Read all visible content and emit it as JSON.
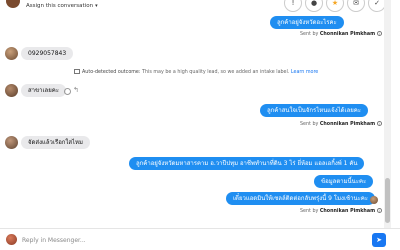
{
  "header": {
    "assign_label": "Assign this conversation",
    "caret": "▾",
    "buttons": [
      {
        "name": "alert-icon",
        "glyph": "!"
      },
      {
        "name": "tag-icon",
        "glyph": "●"
      },
      {
        "name": "star-icon",
        "glyph": "★"
      },
      {
        "name": "mail-icon",
        "glyph": "✉"
      },
      {
        "name": "check-icon",
        "glyph": "✓"
      }
    ]
  },
  "messages": {
    "m1": {
      "text": "ลูกค้าอยู่จังหวัดอะไรคะ"
    },
    "m2": {
      "text": "0929057843"
    },
    "m3": {
      "text": "สาขาเลยคะ"
    },
    "m4": {
      "text": "ลูกค้าสนใจเป็นจักรไหนแจ้งได้เลยคะ"
    },
    "m5": {
      "text": "จัดส่งแล้วเรือกใสไหม"
    },
    "m6": {
      "text": "ลูกค้าอยู่จังหวัดมหาสารคาม อ.วาปีปทุม อาชีพทำนาที่ดิน 3 ไร่ ยี่ห้อม แอลเอกิ้งพ์ 1 คัน"
    },
    "m7": {
      "text": "ข้อมูลตามนี้นะคะ"
    },
    "m8": {
      "text": "เดี๋ยวแอดมินให้เซลล์ติดต่อกลับพรุ่งนี้ 9 โมงเช้านะคะ"
    }
  },
  "sent_by": {
    "prefix": "Sent by",
    "agent": "Chonnikan Pimkham",
    "info": "i"
  },
  "autodetect": {
    "title": "Auto-detected outcome:",
    "text": "This may be a high quality lead, so we added an intake label.",
    "link": "Learn more"
  },
  "reply_icon": "↰",
  "composer": {
    "placeholder": "Reply in Messenger...",
    "send_glyph": "➤"
  },
  "colors": {
    "outgoing_bubble": "#1f8ef1",
    "incoming_bubble": "#e9e9eb",
    "link": "#1877f2"
  }
}
